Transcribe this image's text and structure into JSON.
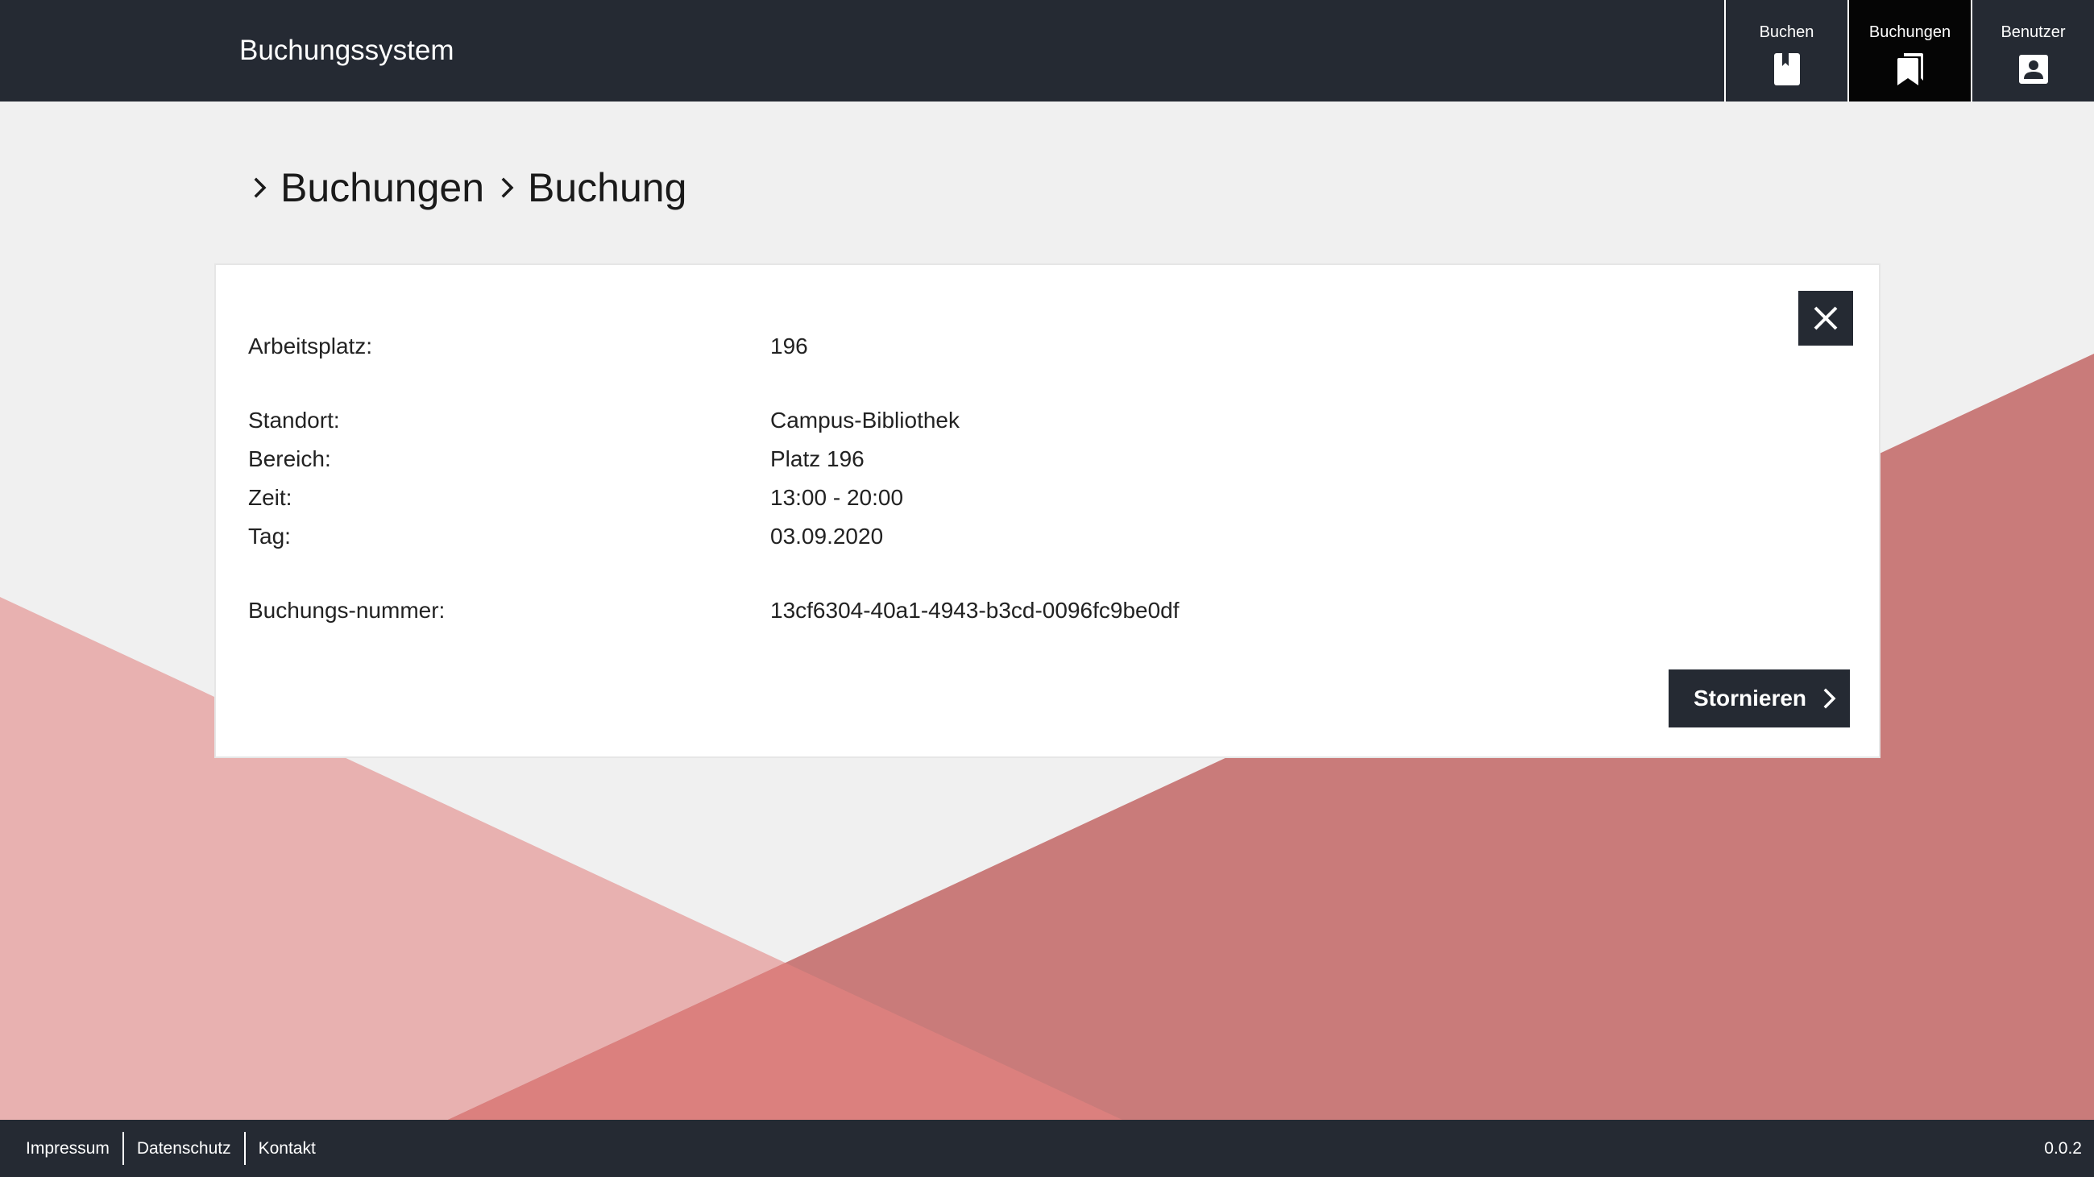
{
  "header": {
    "title": "Buchungssystem",
    "nav": [
      {
        "label": "Buchen",
        "icon": "book-icon",
        "active": false
      },
      {
        "label": "Buchungen",
        "icon": "bookmarks-icon",
        "active": true
      },
      {
        "label": "Benutzer",
        "icon": "user-card-icon",
        "active": false
      }
    ]
  },
  "breadcrumb": {
    "items": [
      "Buchungen",
      "Buchung"
    ]
  },
  "booking": {
    "rows": [
      {
        "label": "Arbeitsplatz:",
        "value": "196"
      },
      {
        "label": "Standort:",
        "value": "Campus-Bibliothek"
      },
      {
        "label": "Bereich:",
        "value": "Platz 196"
      },
      {
        "label": "Zeit:",
        "value": "13:00 - 20:00"
      },
      {
        "label": "Tag:",
        "value": "03.09.2020"
      },
      {
        "label": "Buchungs-nummer:",
        "value": "13cf6304-40a1-4943-b3cd-0096fc9be0df"
      }
    ],
    "cancel_label": "Stornieren",
    "close_icon": "close-icon"
  },
  "footer": {
    "links": [
      "Impressum",
      "Datenschutz",
      "Kontakt"
    ],
    "version": "0.0.2"
  },
  "colors": {
    "dark": "#252a33",
    "active_nav": "#050505",
    "background": "#f0f0f0",
    "shape_light": "#e8b1b0",
    "shape_dark": "#c97b7a",
    "shape_overlap": "#db807e"
  }
}
